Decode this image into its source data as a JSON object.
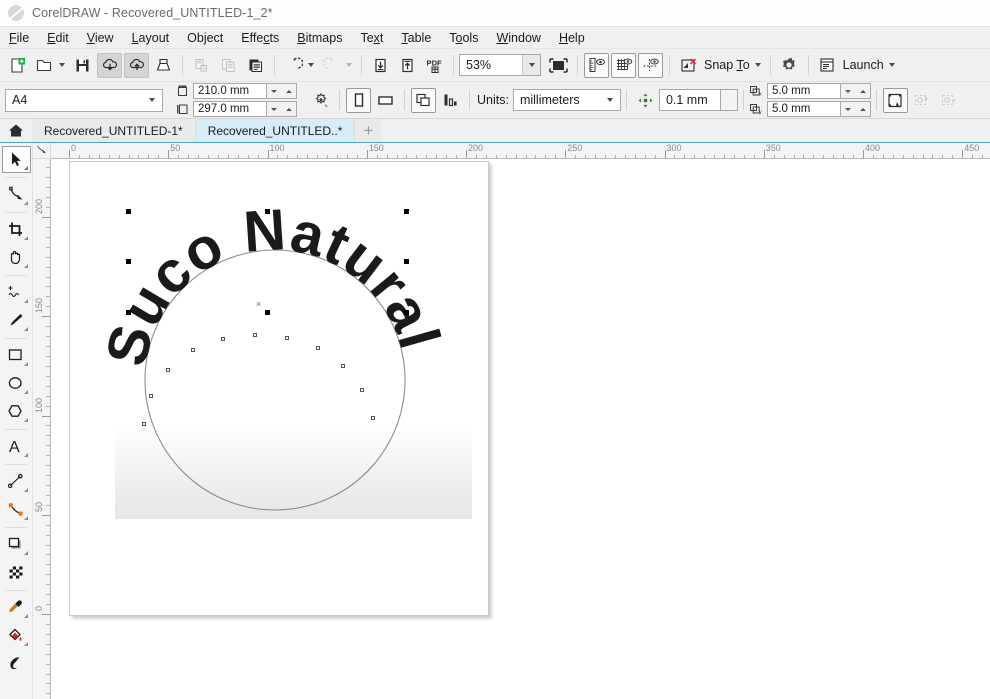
{
  "window": {
    "title": "CorelDRAW - Recovered_UNTITLED-1_2*",
    "logo_icon": "coreldraw-balloon-icon"
  },
  "menubar": {
    "items": [
      {
        "label": "File",
        "mnemonic": "F"
      },
      {
        "label": "Edit",
        "mnemonic": "E"
      },
      {
        "label": "View",
        "mnemonic": "V"
      },
      {
        "label": "Layout",
        "mnemonic": "L"
      },
      {
        "label": "Object",
        "mnemonic": "O"
      },
      {
        "label": "Effects",
        "mnemonic": "c"
      },
      {
        "label": "Bitmaps",
        "mnemonic": "B"
      },
      {
        "label": "Text",
        "mnemonic": "x"
      },
      {
        "label": "Table",
        "mnemonic": "T"
      },
      {
        "label": "Tools",
        "mnemonic": "o"
      },
      {
        "label": "Window",
        "mnemonic": "W"
      },
      {
        "label": "Help",
        "mnemonic": "H"
      }
    ]
  },
  "standard_toolbar": {
    "buttons": [
      {
        "name": "new-document-button",
        "icon": "new-page-icon",
        "state": "normal"
      },
      {
        "name": "open-document-button",
        "icon": "open-folder-icon",
        "state": "normal"
      },
      {
        "name": "open-dropdown-button",
        "icon": "chevron-down-icon",
        "state": "normal"
      },
      {
        "name": "save-document-button",
        "icon": "floppy-disk-icon",
        "state": "normal"
      },
      {
        "name": "download-cloud-button",
        "icon": "cloud-download-icon",
        "state": "pressed"
      },
      {
        "name": "upload-cloud-button",
        "icon": "cloud-upload-icon",
        "state": "pressed"
      },
      {
        "name": "print-button",
        "icon": "printer-icon",
        "state": "normal"
      },
      {
        "name": "cut-button",
        "icon": "scissors-cut-icon",
        "state": "disabled"
      },
      {
        "name": "copy-button",
        "icon": "copy-icon",
        "state": "disabled"
      },
      {
        "name": "paste-button",
        "icon": "clipboard-paste-icon",
        "state": "normal"
      },
      {
        "name": "undo-button",
        "icon": "undo-arrow-icon",
        "state": "normal"
      },
      {
        "name": "undo-dropdown-button",
        "icon": "chevron-down-icon",
        "state": "normal"
      },
      {
        "name": "redo-button",
        "icon": "redo-arrow-icon",
        "state": "disabled"
      },
      {
        "name": "redo-dropdown-button",
        "icon": "chevron-down-icon",
        "state": "disabled"
      },
      {
        "name": "import-button",
        "icon": "import-arrow-down-icon",
        "state": "normal"
      },
      {
        "name": "export-button",
        "icon": "export-arrow-up-icon",
        "state": "normal"
      },
      {
        "name": "export-pdf-button",
        "icon": "pdf-export-icon",
        "state": "normal"
      }
    ],
    "zoom": {
      "value": "53%",
      "dropdown_icon": "chevron-down-icon"
    },
    "full_screen_button": {
      "icon": "full-screen-preview-icon"
    },
    "show_rulers_button": {
      "icon": "ruler-eye-icon",
      "state": "framed"
    },
    "show_grid_button": {
      "icon": "grid-eye-icon",
      "state": "framed"
    },
    "show_guides_button": {
      "icon": "guides-eye-icon",
      "state": "framed"
    },
    "snap_off_button": {
      "icon": "snap-off-icon"
    },
    "snap_to": {
      "label": "Snap To",
      "mnemonic": "T",
      "dropdown_icon": "chevron-down-icon"
    },
    "options_button": {
      "icon": "gear-icon"
    },
    "launch": {
      "label": "Launch",
      "icon": "application-window-icon",
      "dropdown_icon": "chevron-down-icon"
    }
  },
  "property_bar": {
    "page_size": {
      "value": "A4",
      "dropdown_icon": "chevron-down-icon"
    },
    "page_width": {
      "label": "210.0 mm",
      "icon": "page-width-icon"
    },
    "page_height": {
      "label": "297.0 mm",
      "icon": "page-height-icon"
    },
    "page_settings_button": {
      "icon": "page-options-icon"
    },
    "portrait_button": {
      "icon": "portrait-orientation-icon",
      "state": "framed"
    },
    "landscape_button": {
      "icon": "landscape-orientation-icon",
      "state": "normal"
    },
    "all_pages_button": {
      "icon": "all-pages-icon",
      "state": "framed"
    },
    "current_page_button": {
      "icon": "current-page-icon",
      "state": "normal"
    },
    "units": {
      "label": "Units:",
      "value": "millimeters",
      "dropdown_icon": "chevron-down-icon"
    },
    "nudge": {
      "value": "0.1 mm",
      "icon": "nudge-arrows-icon"
    },
    "duplicate_x": {
      "label": "5.0 mm",
      "icon": "duplicate-x-icon"
    },
    "duplicate_y": {
      "label": "5.0 mm",
      "icon": "duplicate-y-icon"
    },
    "treat_as_filled_button": {
      "icon": "treat-as-filled-icon",
      "state": "framed"
    },
    "open_curve_button": {
      "icon": "edit-open-curve-icon",
      "state": "disabled"
    },
    "closed_curve_button": {
      "icon": "edit-closed-curve-icon",
      "state": "disabled"
    }
  },
  "tabs": {
    "home_icon": "home-icon",
    "new_tab_icon": "plus-icon",
    "items": [
      {
        "label": "Recovered_UNTITLED-1*",
        "active": false
      },
      {
        "label": "Recovered_UNTITLED..*",
        "active": true
      }
    ]
  },
  "toolbox": {
    "tools": [
      {
        "name": "pick-tool",
        "icon": "arrow-cursor-icon",
        "active": true,
        "flyout": false
      },
      {
        "name": "shape-tool",
        "icon": "shape-node-icon",
        "active": false,
        "flyout": true
      },
      {
        "name": "crop-tool",
        "icon": "crop-icon",
        "active": false,
        "flyout": true
      },
      {
        "name": "pan-tool",
        "icon": "hand-icon",
        "active": false,
        "flyout": true
      },
      {
        "name": "freehand-tool",
        "icon": "freehand-curve-icon",
        "active": false,
        "flyout": true
      },
      {
        "name": "artistic-media-tool",
        "icon": "paintbrush-icon",
        "active": false,
        "flyout": true
      },
      {
        "name": "rectangle-tool",
        "icon": "rectangle-icon",
        "active": false,
        "flyout": true
      },
      {
        "name": "ellipse-tool",
        "icon": "ellipse-icon",
        "active": false,
        "flyout": true
      },
      {
        "name": "polygon-tool",
        "icon": "polygon-icon",
        "active": false,
        "flyout": true
      },
      {
        "name": "text-tool",
        "icon": "text-a-icon",
        "active": false,
        "flyout": true
      },
      {
        "name": "dimension-tool",
        "icon": "dimension-line-icon",
        "active": false,
        "flyout": true
      },
      {
        "name": "connector-tool",
        "icon": "connector-line-icon",
        "active": false,
        "flyout": true
      },
      {
        "name": "drop-shadow-tool",
        "icon": "drop-shadow-icon",
        "active": false,
        "flyout": true
      },
      {
        "name": "transparency-tool",
        "icon": "transparency-checker-icon",
        "active": false,
        "flyout": false
      },
      {
        "name": "color-eyedropper-tool",
        "icon": "eyedropper-icon",
        "active": false,
        "flyout": true
      },
      {
        "name": "fill-tool",
        "icon": "paint-bucket-icon",
        "active": false,
        "flyout": true
      },
      {
        "name": "interactive-fill-tool",
        "icon": "interactive-fill-icon",
        "active": false,
        "flyout": false
      }
    ]
  },
  "rulers": {
    "origin_icon": "ruler-origin-icon",
    "unit": "mm",
    "horizontal_labels": [
      "0",
      "50",
      "100",
      "150",
      "200",
      "250",
      "300",
      "350",
      "400",
      "450"
    ],
    "vertical_labels": [
      "200",
      "150",
      "100",
      "50",
      "0"
    ]
  },
  "canvas": {
    "artwork": {
      "text_on_path": "Suco Natural",
      "path_shape": "circle",
      "text_color": "#1a1a1a",
      "circle_stroke": "#8c8c8c",
      "gradient_rect_from": "#ffffff",
      "gradient_rect_to": "#e6e6e6",
      "selection_handle_color": "#000000",
      "node_marker_color": "#ffffff",
      "center_marker": "×"
    },
    "page_background": "#ffffff"
  }
}
